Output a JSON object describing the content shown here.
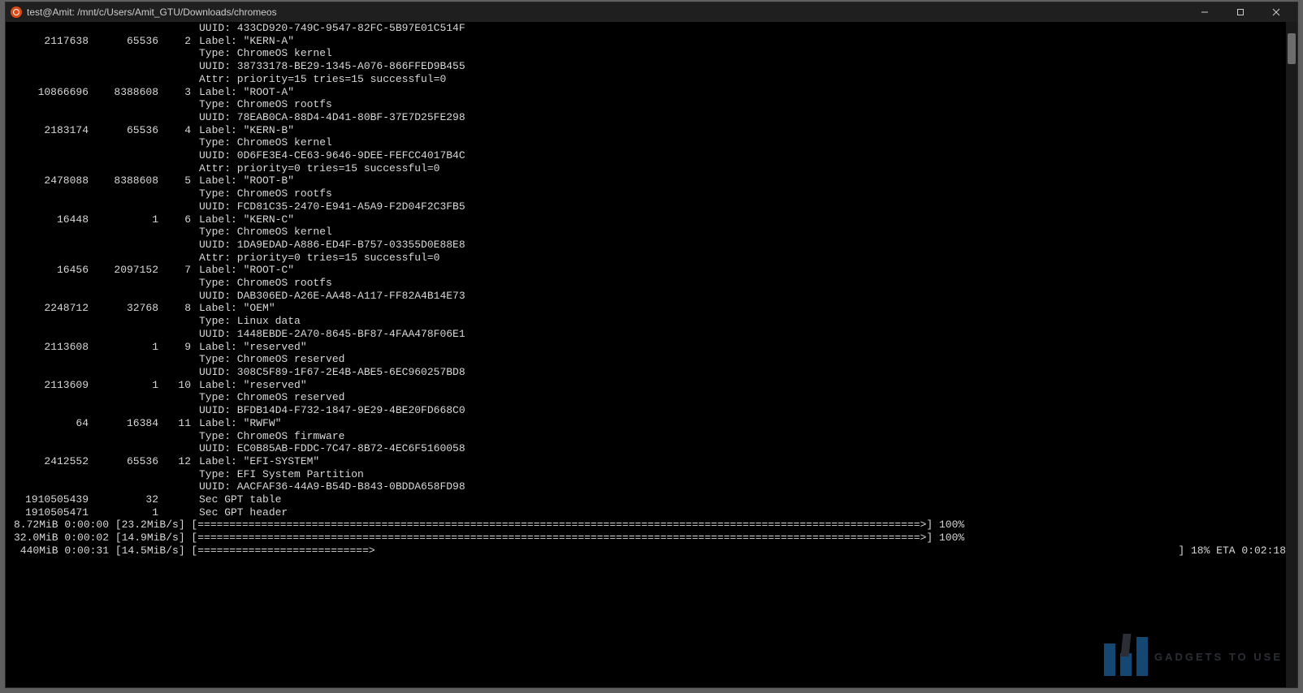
{
  "titlebar": {
    "title": "test@Amit: /mnt/c/Users/Amit_GTU/Downloads/chromeos"
  },
  "pre_lines": [
    "UUID: 433CD920-749C-9547-82FC-5B97E01C514F"
  ],
  "partitions": [
    {
      "start": "2117638",
      "size": "65536",
      "num": "2",
      "lines": [
        "Label: \"KERN-A\"",
        "Type: ChromeOS kernel",
        "UUID: 38733178-BE29-1345-A076-866FFED9B455",
        "Attr: priority=15 tries=15 successful=0"
      ]
    },
    {
      "start": "10866696",
      "size": "8388608",
      "num": "3",
      "lines": [
        "Label: \"ROOT-A\"",
        "Type: ChromeOS rootfs",
        "UUID: 78EAB0CA-88D4-4D41-80BF-37E7D25FE298"
      ]
    },
    {
      "start": "2183174",
      "size": "65536",
      "num": "4",
      "lines": [
        "Label: \"KERN-B\"",
        "Type: ChromeOS kernel",
        "UUID: 0D6FE3E4-CE63-9646-9DEE-FEFCC4017B4C",
        "Attr: priority=0 tries=15 successful=0"
      ]
    },
    {
      "start": "2478088",
      "size": "8388608",
      "num": "5",
      "lines": [
        "Label: \"ROOT-B\"",
        "Type: ChromeOS rootfs",
        "UUID: FCD81C35-2470-E941-A5A9-F2D04F2C3FB5"
      ]
    },
    {
      "start": "16448",
      "size": "1",
      "num": "6",
      "lines": [
        "Label: \"KERN-C\"",
        "Type: ChromeOS kernel",
        "UUID: 1DA9EDAD-A886-ED4F-B757-03355D0E88E8",
        "Attr: priority=0 tries=15 successful=0"
      ]
    },
    {
      "start": "16456",
      "size": "2097152",
      "num": "7",
      "lines": [
        "Label: \"ROOT-C\"",
        "Type: ChromeOS rootfs",
        "UUID: DAB306ED-A26E-AA48-A117-FF82A4B14E73"
      ]
    },
    {
      "start": "2248712",
      "size": "32768",
      "num": "8",
      "lines": [
        "Label: \"OEM\"",
        "Type: Linux data",
        "UUID: 1448EBDE-2A70-8645-BF87-4FAA478F06E1"
      ]
    },
    {
      "start": "2113608",
      "size": "1",
      "num": "9",
      "lines": [
        "Label: \"reserved\"",
        "Type: ChromeOS reserved",
        "UUID: 308C5F89-1F67-2E4B-ABE5-6EC960257BD8"
      ]
    },
    {
      "start": "2113609",
      "size": "1",
      "num": "10",
      "lines": [
        "Label: \"reserved\"",
        "Type: ChromeOS reserved",
        "UUID: BFDB14D4-F732-1847-9E29-4BE20FD668C0"
      ]
    },
    {
      "start": "64",
      "size": "16384",
      "num": "11",
      "lines": [
        "Label: \"RWFW\"",
        "Type: ChromeOS firmware",
        "UUID: EC0B85AB-FDDC-7C47-8B72-4EC6F5160058"
      ]
    },
    {
      "start": "2412552",
      "size": "65536",
      "num": "12",
      "lines": [
        "Label: \"EFI-SYSTEM\"",
        "Type: EFI System Partition",
        "UUID: AACFAF36-44A9-B54D-B843-0BDDA658FD98"
      ]
    }
  ],
  "trailer_rows": [
    {
      "start": "1910505439",
      "size": "32",
      "num": "",
      "text": "Sec GPT table"
    },
    {
      "start": "1910505471",
      "size": "1",
      "num": "",
      "text": "Sec GPT header"
    }
  ],
  "progress": [
    {
      "left": "8.72MiB 0:00:00 [23.2MiB/s] [==================================================================================================================>] 100%",
      "right": ""
    },
    {
      "left": "32.0MiB 0:00:02 [14.9MiB/s] [==================================================================================================================>] 100%",
      "right": ""
    },
    {
      "left": " 440MiB 0:00:31 [14.5MiB/s] [===========================>",
      "right": "] 18% ETA 0:02:18"
    }
  ],
  "watermark": {
    "text": "GADGETS TO USE"
  }
}
